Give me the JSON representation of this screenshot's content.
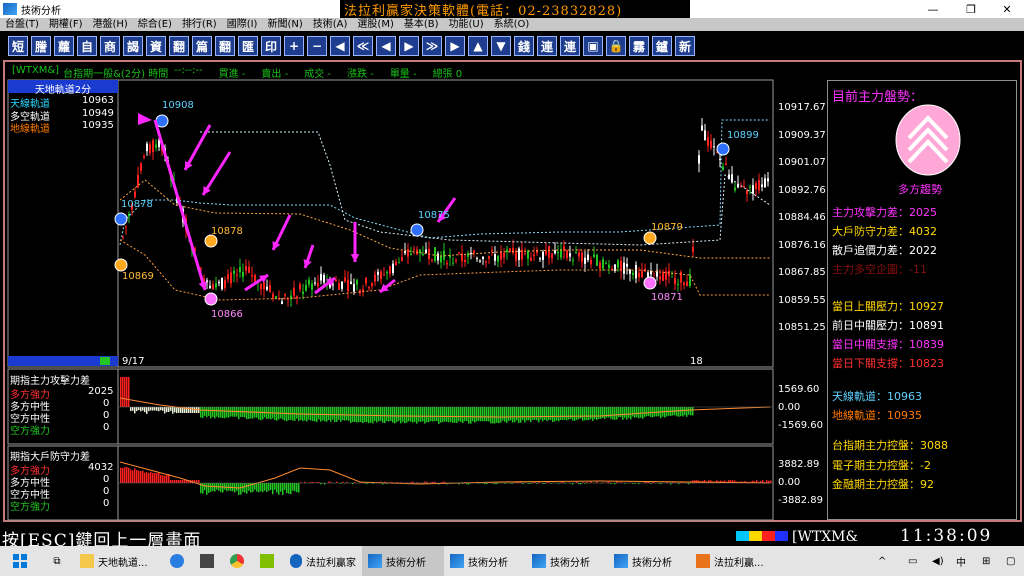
{
  "window": {
    "title": "技術分析",
    "banner": "法拉利贏家決策軟體(電話：02-23832828)"
  },
  "menu": [
    "台盤(T)",
    "期權(F)",
    "港盤(H)",
    "綜合(E)",
    "排行(R)",
    "國際(I)",
    "新聞(N)",
    "技術(A)",
    "選股(M)",
    "基本(B)",
    "功能(U)",
    "系統(O)"
  ],
  "toolbar": [
    "短",
    "謄",
    "蘿",
    "自",
    "商",
    "謁",
    "資",
    "翻",
    "篇",
    "翻",
    "匯",
    "印",
    "+",
    "−",
    "◀",
    "≪",
    "◀",
    "▶",
    "≫",
    "▶",
    "▲",
    "▼",
    "錢",
    "連",
    "連",
    "▣",
    "🔒",
    "霧",
    "鑪",
    "新"
  ],
  "header": {
    "symbol": "[WTXM&]",
    "name": "台指期一般&(2分) 時間",
    "time": "--:--:--",
    "buy": "買進 -",
    "sell": "賣出 -",
    "trade": "成交 -",
    "change": "漲跌 -",
    "volume": "單量 -",
    "total": "總張 0"
  },
  "indicator": {
    "title": "天地軌道2分",
    "sky_label": "天線軌道",
    "sky": "10963",
    "mid_label": "多空軌道",
    "mid": "10949",
    "ground_label": "地線軌道",
    "ground": "10935"
  },
  "price_axis": [
    "10917.67",
    "10909.37",
    "10901.07",
    "10892.76",
    "10884.46",
    "10876.16",
    "10867.85",
    "10859.55",
    "10851.25"
  ],
  "annotations": {
    "a1": "10908",
    "a2": "10878",
    "a3": "10878",
    "a4": "10869",
    "a5": "10866",
    "a6": "10875",
    "a7": "10879",
    "a8": "10871",
    "a9": "10899"
  },
  "xaxis": {
    "start": "9/17",
    "mid": "18"
  },
  "sub1": {
    "title": "期指主力攻擊力差",
    "l1": "多方強力",
    "v1": "2025",
    "l2": "多方中性",
    "v2": "0",
    "l3": "空方中性",
    "v3": "0",
    "l4": "空方強力",
    "v4": "0",
    "top": "1569.60",
    "zero": "0.00",
    "bottom": "-1569.60"
  },
  "sub2": {
    "title": "期指大戶防守力差",
    "l1": "多方強力",
    "v1": "4032",
    "l2": "多方中性",
    "v2": "0",
    "l3": "空方中性",
    "v3": "0",
    "l4": "空方強力",
    "v4": "0",
    "top": "3882.89",
    "zero": "0.00",
    "bottom": "-3882.89"
  },
  "panel": {
    "title": "目前主力盤勢：",
    "trend": "多方趨勢",
    "r1": "主力攻擊力差：2025",
    "r2": "大戶防守力差：4032",
    "r3": "散戶追價力差：2022",
    "r4": "主力多空企圖：-11",
    "r5": "當日上關壓力：10927",
    "r6": "前日中關壓力：10891",
    "r7": "當日中關支撐：10839",
    "r8": "當日下關支撐：10823",
    "r9": "天線軌道：10963",
    "r10": "地線軌道：10935",
    "r11": "台指期主力控盤：3088",
    "r12": "電子期主力控盤：-2",
    "r13": "金融期主力控盤：92"
  },
  "status": {
    "hint": "按[ESC]鍵回上一層畫面",
    "code": "[WTXM&",
    "clock": "11:38:09"
  },
  "taskbar": [
    "天地軌道...",
    "法拉利贏家",
    "技術分析",
    "技術分析",
    "技術分析",
    "技術分析",
    "法拉利贏..."
  ],
  "tray": {
    "lang": "中"
  },
  "colors": {
    "up": "#ff2020",
    "down": "#22c522",
    "accent": "#ff26ff",
    "banner": "#ff9a00"
  }
}
